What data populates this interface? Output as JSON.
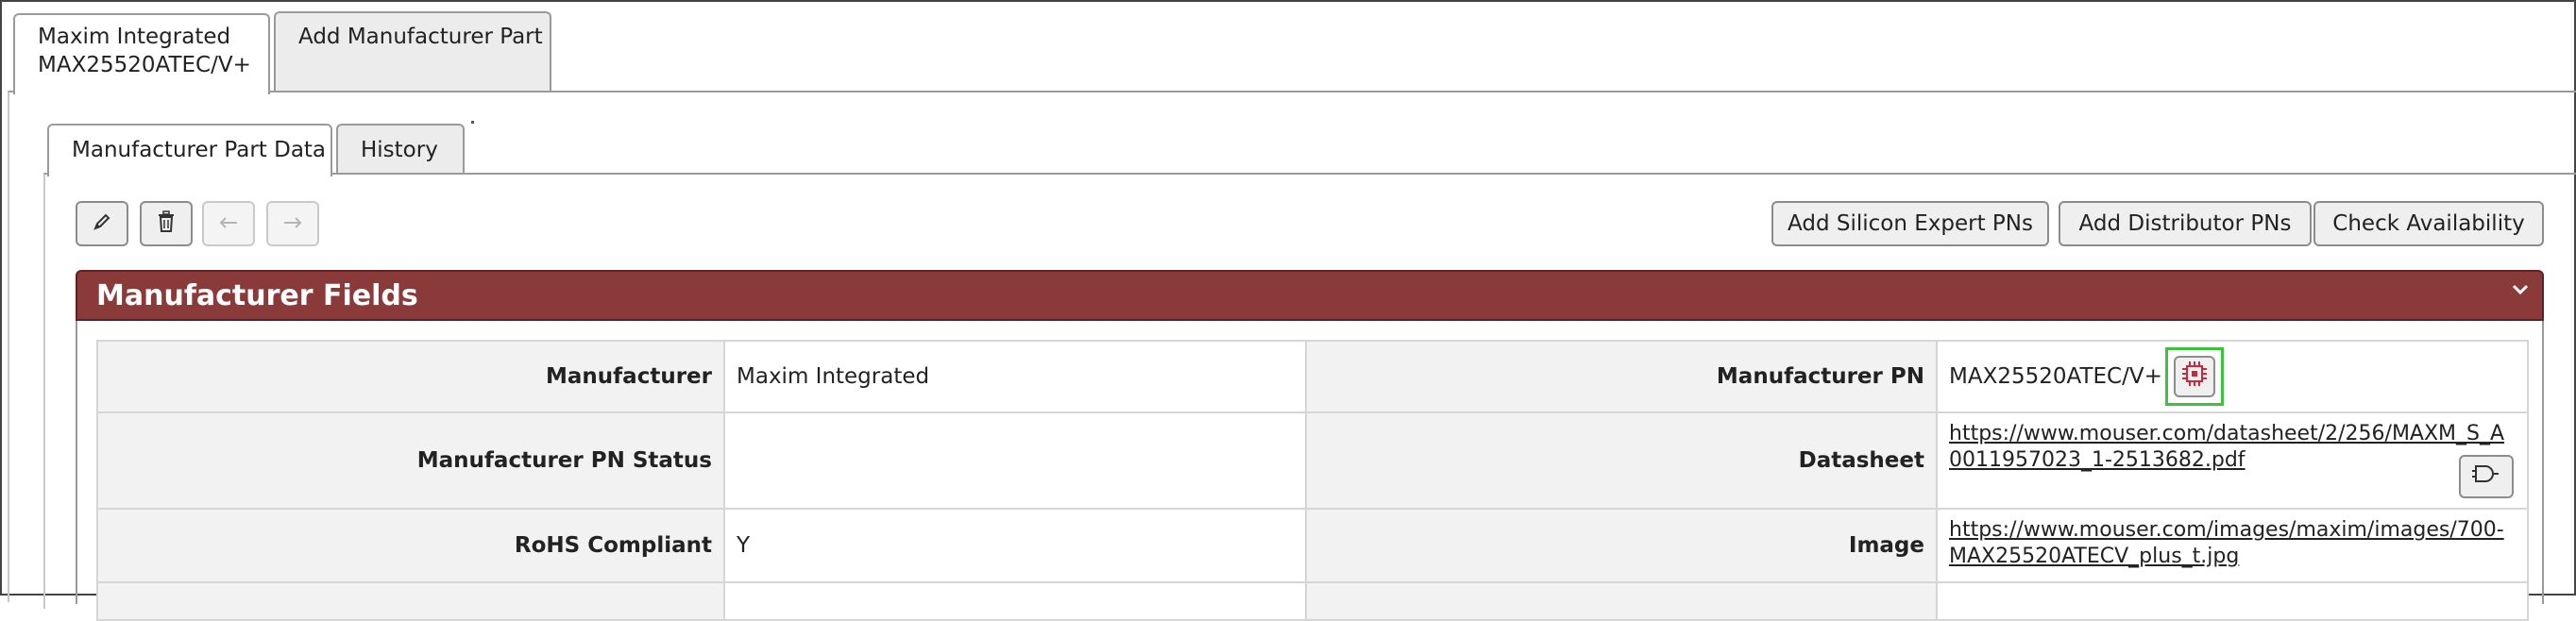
{
  "top_tabs": [
    {
      "line1": "Maxim Integrated",
      "line2": "MAX25520ATEC/V+",
      "active": true
    },
    {
      "line1": "Add Manufacturer Part",
      "active": false
    }
  ],
  "sub_tabs": [
    {
      "label": "Manufacturer Part Data",
      "active": true
    },
    {
      "label": "History",
      "active": false
    }
  ],
  "toolbar": {
    "icons": [
      "pencil-icon",
      "trash-icon",
      "arrow-left-icon",
      "arrow-right-icon"
    ],
    "add_silicon_expert_label": "Add Silicon Expert PNs",
    "add_distributor_label": "Add Distributor PNs",
    "check_availability_label": "Check Availability"
  },
  "section": {
    "title": "Manufacturer Fields",
    "header_color": "#8b3a3a"
  },
  "fields": {
    "manufacturer_label": "Manufacturer",
    "manufacturer_value": "Maxim Integrated",
    "manufacturer_pn_label": "Manufacturer PN",
    "manufacturer_pn_value": "MAX25520ATEC/V+",
    "manufacturer_pn_status_label": "Manufacturer PN Status",
    "manufacturer_pn_status_value": "",
    "datasheet_label": "Datasheet",
    "datasheet_value": "https://www.mouser.com/datasheet/2/256/MAXM_S_A0011957023_1-2513682.pdf",
    "rohs_label": "RoHS Compliant",
    "rohs_value": "Y",
    "image_label": "Image",
    "image_value": "https://www.mouser.com/images/maxim/images/700-MAX25520ATECV_plus_t.jpg"
  },
  "colors": {
    "accent_green": "#3cc23c",
    "chip_red": "#c8283c"
  }
}
